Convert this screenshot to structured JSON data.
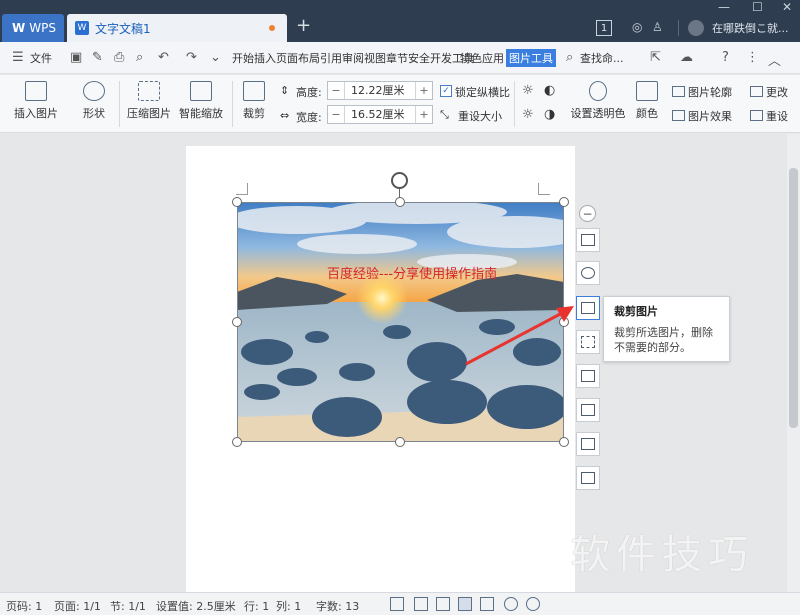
{
  "titlebar": {
    "app_tab": "WPS",
    "app_logo": "W",
    "doc_tab": "文字文稿1",
    "doc_icon": "W",
    "new_tab": "+",
    "page_count_badge": "1",
    "user_label": "在哪跌倒こ就...",
    "window_controls": [
      "—",
      "☐",
      "✕"
    ]
  },
  "menubar": {
    "file_label": "文件",
    "tabs": [
      "开始",
      "插入",
      "页面布局",
      "引用",
      "审阅",
      "视图",
      "章节",
      "安全",
      "开发工具",
      "特色应用",
      "图片工具"
    ],
    "active_tab": "图片工具",
    "search_label": "查找命..."
  },
  "ribbon": {
    "insert_picture": "插入图片",
    "shape": "形状",
    "compress": "压缩图片",
    "smart_zoom": "智能缩放",
    "crop": "裁剪",
    "height_label": "高度:",
    "height_value": "12.22厘米",
    "width_label": "宽度:",
    "width_value": "16.52厘米",
    "minus": "−",
    "plus": "+",
    "lock_ratio": "锁定纵横比",
    "reset_size": "重设大小",
    "set_transparent": "设置透明色",
    "color": "颜色",
    "pic_outline": "图片轮廓",
    "pic_effect": "图片效果",
    "change": "更改",
    "reset": "重设"
  },
  "document": {
    "overlay_text": "百度经验---分享使用操作指南",
    "tooltip_title": "裁剪图片",
    "tooltip_body": "裁剪所选图片，删除不需要的部分。",
    "watermark": "软件技巧"
  },
  "statusbar": {
    "page_num": "页码: 1",
    "page": "页面: 1/1",
    "section": "节: 1/1",
    "setting": "设置值: 2.5厘米",
    "row": "行: 1",
    "col": "列: 1",
    "word_count": "字数: 13"
  },
  "colors": {
    "titlebar": "#2e3d4f",
    "accent": "#3a7fe0",
    "overlay_text": "#d6252a"
  }
}
